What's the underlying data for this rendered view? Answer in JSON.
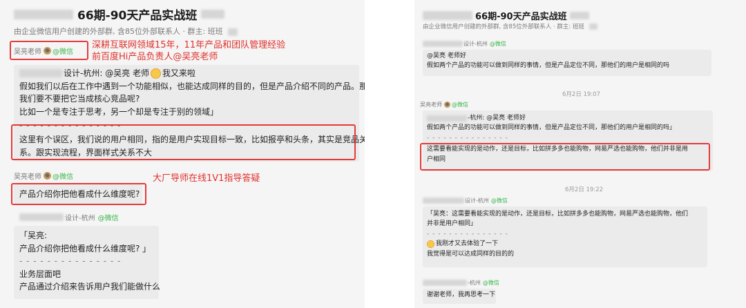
{
  "left": {
    "title": "66期-90天产品实战班",
    "subtitle": "由企业微信用户创建的外部群, 含85位外部联系人 · 群主: 班班",
    "sender_teacher": "吴亮老师",
    "wechat_tag": "@微信",
    "annotation_intro_1": "深耕互联网领域15年，11年产品和团队管理经验",
    "annotation_intro_2": "前百度Hi产品负责人@吴亮老师",
    "msg1": {
      "quote_header": "设计-杭州: @吴亮 老师",
      "quote_tail": "我又来啦",
      "lines": [
        "假如我们以后在工作中遇到一个功能相似，也能达成同样的目的，但是产品介绍不同的产品。那",
        "我们要不要把它当成核心竞品呢?",
        "比如一个是专注于思考，另一个却是专注于别的领域」"
      ],
      "divider": "- - - - - - - - - - - - - - -",
      "answer_lines": [
        "这里有个误区，我们说的用户相同，指的是用户实现目标一致，比如报亭和头条，其实是竞品关",
        "系。跟实现流程，界面样式关系不大"
      ]
    },
    "annotation_mentor": "大厂导师在线1V1指导答疑",
    "msg2": "产品介绍你把他看成什么维度呢?",
    "sender_student": "设计-杭州",
    "msg3": {
      "lines": [
        "「吴亮:",
        "产品介绍你把他看成什么维度呢? 」"
      ],
      "divider": "- - - - - - - - - - - - - - -",
      "after_lines": [
        "业务层面吧",
        "产品通过介绍来告诉用户我们能做什么"
      ]
    }
  },
  "right": {
    "title": "66期-90天产品实战班",
    "subtitle": "由企业微信用户创建的外部群, 含85位外部联系人 · 群主: 班班",
    "sender_student": "设计-杭州",
    "wechat_tag": "@微信",
    "msg1_lines": [
      "@吴亮 老师好",
      "假如两个产品的功能可以做到同样的事情，但是产品定位不同，那他们的用户是相同的吗"
    ],
    "time1": "6月2日 19:07",
    "sender_teacher": "吴亮老师",
    "msg2": {
      "quote_header": "-杭州: @吴亮 老师好",
      "quote_line": "假如两个产品的功能可以做到同样的事情，但是产品定位不同，那他们的用户是相同的吗」",
      "divider": "- - - - - - - - - - - - - - -",
      "answer_lines": [
        "这需要看能实现的是动作，还是目标，比如拼多多也能购物，网易严选也能购物，他们并非是用",
        "户相同"
      ]
    },
    "time2": "6月2日 19:22",
    "sender_student_2": "设计-杭州",
    "msg3": {
      "lines": [
        "「吴亮：这需要看能实现的是动作，还是目标，比如拼多多也能购物，网易严选也能购物，他们",
        "并非是用户相同」"
      ],
      "divider": "- - - - - - - - - - - - - - -",
      "after_lines": [
        "我刚才又去体验了一下",
        "我觉得是可以达成同样的目的的"
      ]
    },
    "sender_student_3": "-杭州",
    "msg4": "谢谢老师，我再思考一下"
  },
  "colors": {
    "accent_red": "#e23a3a",
    "wechat_green": "#3ab54a",
    "bubble_bg": "#ebebeb",
    "panel_bg": "#f5f5f5"
  }
}
